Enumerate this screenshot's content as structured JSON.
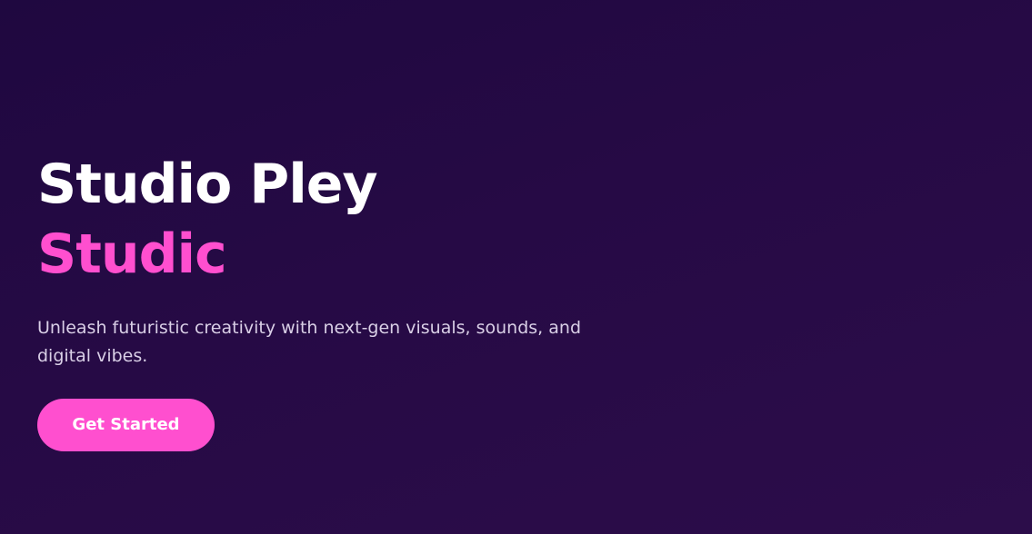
{
  "hero": {
    "title_line1": "Studio Pley",
    "title_line2": "Studic",
    "subtitle": "Unleash futuristic creativity with next-gen visuals, sounds, and digital vibes.",
    "cta_label": "Get Started"
  },
  "colors": {
    "background": "#240a43",
    "accent": "#ff4fcf",
    "title": "#ffffff",
    "subtitle": "#d9cfe6"
  }
}
